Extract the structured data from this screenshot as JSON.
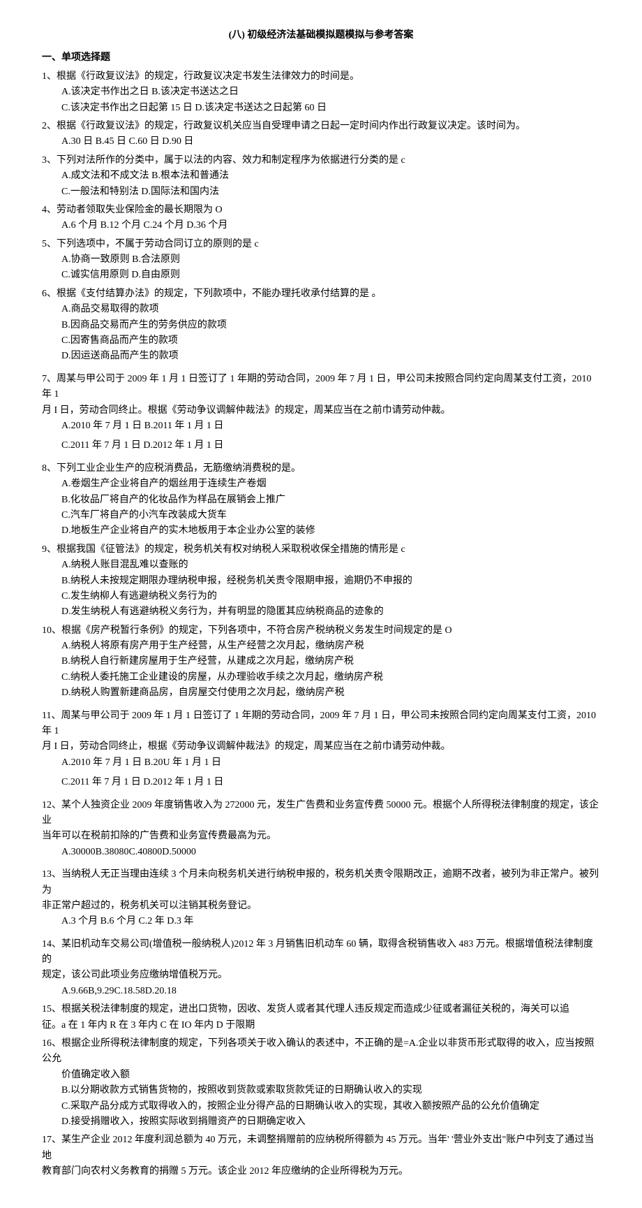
{
  "title": "(八) 初级经济法基础模拟题模拟与参考答案",
  "section_header": "一、单项选择题",
  "questions": [
    {
      "num": "1、",
      "text": "根据《行政复议法》的规定，行政复议决定书发生法律效力的时间是。",
      "opts": [
        "A.该决定书作出之日 B.该决定书送达之日",
        "C.该决定书作出之日起第 15 日        D.该决定书送达之日起第 60 日"
      ]
    },
    {
      "num": "2、",
      "text": "根据《行政复议法》的规定，行政复议机关应当自受理申请之日起一定时间内作出行政复议决定。该时间为。",
      "opts": [
        "A.30 日 B.45 日 C.60 日 D.90 日"
      ]
    },
    {
      "num": "3、",
      "text": "下列对法所作的分类中，属于以法的内容、效力和制定程序为依据进行分类的是 c",
      "opts": [
        "A.成文法和不成文法        B.根本法和普通法",
        "C.一般法和特别法 D.国际法和国内法"
      ]
    },
    {
      "num": "4、",
      "text": "劳动者领取失业保险金的最长期限为 O",
      "opts": [
        "A.6 个月         B.12 个月 C.24 个月              D.36 个月"
      ]
    },
    {
      "num": "5、",
      "text": "下列选项中，不属于劳动合同订立的原则的是 c",
      "opts": [
        "A.协商一致原则        B.合法原则",
        "C.诚实信用原则        D.自由原则"
      ]
    },
    {
      "num": "6、",
      "text": "根据《支付结算办法》的规定，下列款项中，不能办理托收承付结算的是 。",
      "opts": [
        "A.商品交易取得的款项",
        "B.因商品交易而产生的劳务供应的款项",
        "C.因寄售商品而产生的款项",
        "D.因运送商品而产生的款项"
      ]
    },
    {
      "num": "7、",
      "text": "周某与甲公司于 2009 年 1 月 1 日签订了 1 年期的劳动合同，2009 年 7 月 1 日，甲公司未按照合同约定向周某支付工资，2010 年 1",
      "extra": "月 I 日，劳动合同终止。根据《劳动争议调解仲裁法》的规定，周某应当在之前巾请劳动仲裁。",
      "opts": [
        "A.2010 年 7 月 1 日       B.2011 年 1 月 1 日",
        "C.2011 年 7 月 1 日       D.2012 年 1 月 1 日"
      ]
    },
    {
      "num": "8、",
      "text": "下列工业企业生产的应税消费品，无筋缴纳消费税的是。",
      "opts": [
        "A.卷烟生产企业将自产的烟丝用于连续生产卷烟",
        "B.化妆品厂将自产的化妆品作为样品在展销会上推广",
        "C.汽车厂将自产的小汽车改装成大货车",
        "D.地板生产企业将自产的实木地板用于本企业办公室的装修"
      ]
    },
    {
      "num": "9、",
      "text": "根据我国《征管法》的规定，税务机关有权对纳税人采取税收保全措施的情形是 c",
      "opts": [
        "A.纳税人账目混乱难以查账的",
        "B.纳税人未按规定期限办理纳税申报，经税务机关责令限期申报，逾期仍不申报的",
        "C.发生纳柳人有逃避纳税义务行为的",
        "D.发生纳税人有逃避纳税义务行为，并有明显的隐匿其应纳税商品的迹象的"
      ]
    },
    {
      "num": "10、",
      "text": "根据《房产税暂行条例》的规定，下列各项中，不符合房产税纳税义务发生时间规定的是 O",
      "opts": [
        "A.纳税人将原有房产用于生产经营，从生产经营之次月起，缴纳房产税",
        "B.纳税人自行新建房屋用于生产经营，从建成之次月起，缴纳房产税",
        "C.纳税人委托施工企业建设的房屋，从办理验收手续之次月起，缴纳房产税",
        "D.纳税人购置新建商品房，自房屋交付使用之次月起，缴纳房产税"
      ]
    },
    {
      "num": "11、",
      "text": "周某与甲公司于 2009 年 1 月 1 日签订了 1 年期的劳动合同，2009 年 7 月 1 日，甲公司未按照合同约定向周某支付工资，2010 年 1",
      "extra": "月 I 日，劳动合同终止，根据《劳动争议调解仲裁法》的规定，周某应当在之前巾请劳动仲裁。",
      "opts": [
        "A.2010 年 7 月 1 日       B.20U 年 1 月 1 日",
        "C.2011 年 7 月 1 日       D.2012 年 1 月 1 日"
      ]
    },
    {
      "num": "12、",
      "text": "某个人独资企业 2009 年度销售收入为 272000 元，发生广告费和业务宣传费 50000 元。根据个人所得税法律制度的规定，该企业",
      "extra": "当年可以在税前扣除的广告费和业务宣传费最高为元。",
      "opts": [
        "A.30000B.38080C.40800D.50000"
      ]
    },
    {
      "num": "13、",
      "text": "当纳税人无正当理由连续 3 个月未向税务机关进行纳税申报的，税务机关责令限期改正，逾期不改者，被列为非正常户。被列为",
      "extra": "非正常户超过的，税务机关可以注销其税务登记。",
      "opts": [
        "A.3 个月        B.6 个月 C.2 年              D.3 年"
      ]
    },
    {
      "num": "14、",
      "text": "某旧机动车交易公司(增值税一般纳税人)2012 年 3 月销售旧机动车 60 辆，取得含税销售收入 483 万元。根据增值税法律制度的",
      "extra": "规定，该公司此项业务应缴纳增值税万元。",
      "opts": [
        "A.9.66B,9.29C.18.58D.20.18"
      ]
    },
    {
      "num": "15、",
      "text": "根据关税法律制度的规定，进出口货物，因收、发货人或者其代理人违反规定而造成少征或者漏征关税的，海关可以追",
      "extra": "征。a 在 1 年内 R 在 3 年内       C 在 IO 年内       D 于限期",
      "opts": []
    },
    {
      "num": "16、",
      "text": "根据企业所得税法律制度的规定，下列各项关于收入确认的表述中，不正确的是=A.企业以非货币形式取得的收入，应当按照公允",
      "opts": [
        "价值确定收入额",
        "B.以分期收款方式销售货物的，按照收到货款或索取货款凭证的日期确认收入的实现",
        "C.采取产品分成方式取得收入的，按照企业分得产品的日期确认收入的实现，其收入额按照产品的公允价值确定",
        "D.接受捐赠收入，按照实际收到捐赠资产的日期确定收入"
      ]
    },
    {
      "num": "17、",
      "text": "某生产企业 2012 年度利润总额为 40 万元，未调整捐赠前的应纳税所得额为 45 万元。当年' '营业外支出\"账户中列支了通过当地",
      "extra": "教育部门向农村义务教育的捐赠 5 万元。该企业 2012 年应缴纳的企业所得税为万元。",
      "opts": []
    }
  ]
}
